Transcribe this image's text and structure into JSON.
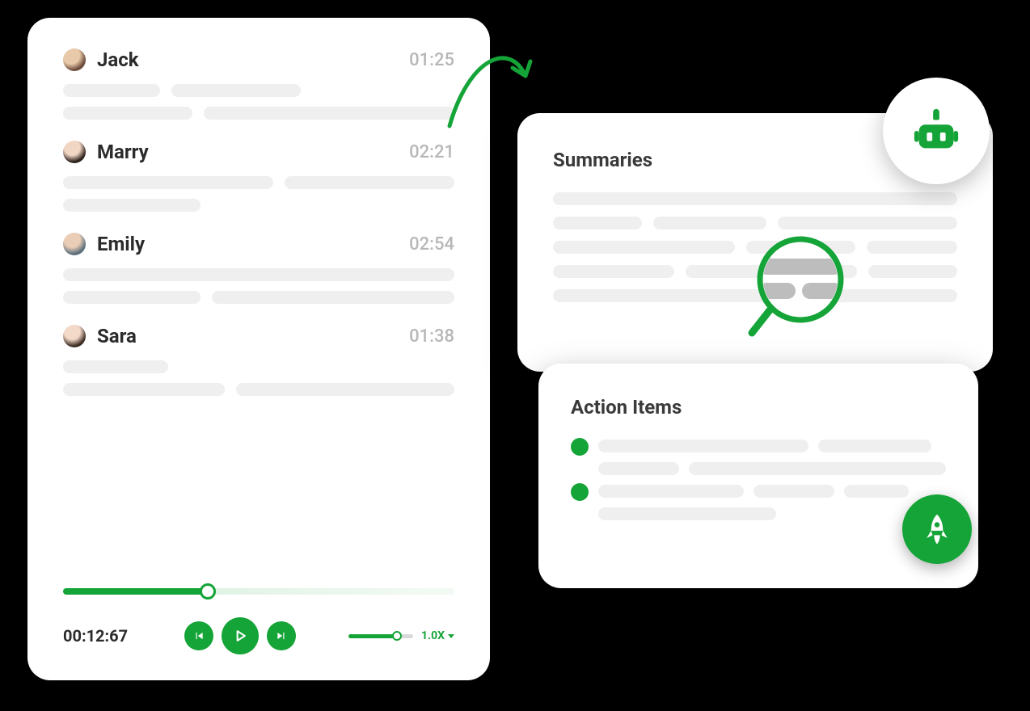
{
  "transcript": {
    "speakers": [
      {
        "name": "Jack",
        "time": "01:25"
      },
      {
        "name": "Marry",
        "time": "02:21"
      },
      {
        "name": "Emily",
        "time": "02:54"
      },
      {
        "name": "Sara",
        "time": "01:38"
      }
    ],
    "player": {
      "elapsed": "00:12:67",
      "speed_label": "1.0X"
    }
  },
  "summaries": {
    "title": "Summaries"
  },
  "action_items": {
    "title": "Action Items"
  },
  "colors": {
    "accent": "#15a437"
  }
}
